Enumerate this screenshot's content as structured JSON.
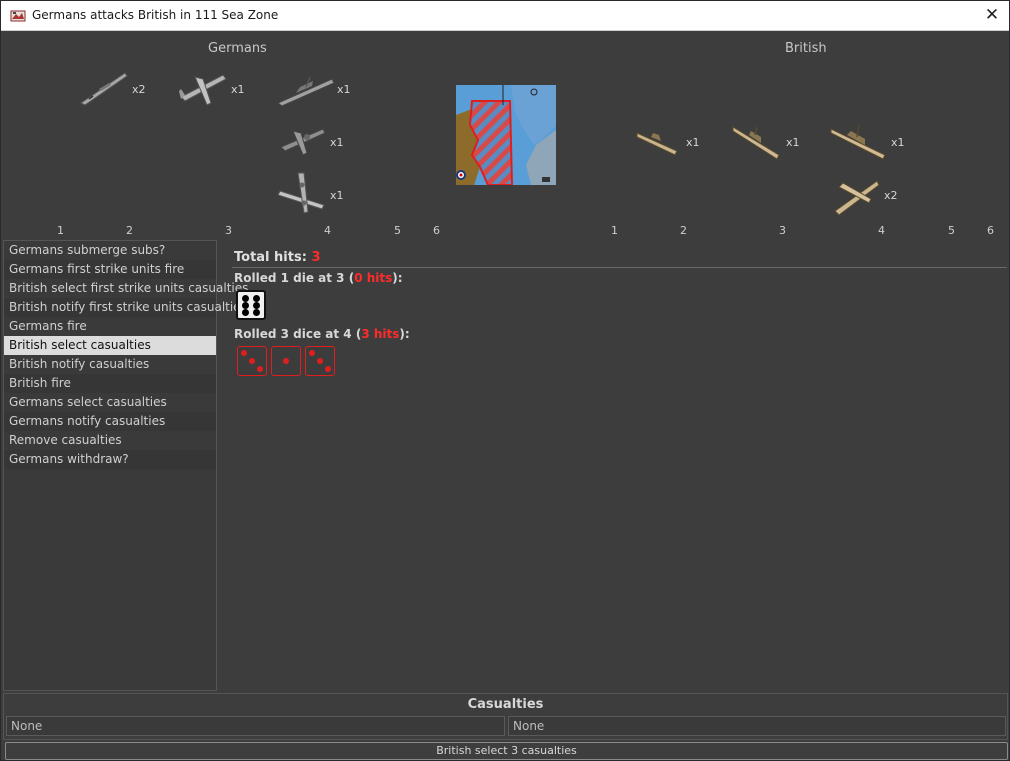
{
  "window": {
    "title": "Germans attacks British in 111 Sea Zone"
  },
  "attacker": {
    "label": "Germans",
    "units": [
      {
        "name": "destroyer",
        "count": "x2"
      },
      {
        "name": "fighter",
        "count": "x1"
      },
      {
        "name": "battleship",
        "count": "x1"
      },
      {
        "name": "tactical-bomber",
        "count": "x1"
      },
      {
        "name": "bomber",
        "count": "x1"
      }
    ],
    "columns": [
      "1",
      "2",
      "3",
      "4",
      "5",
      "6"
    ]
  },
  "defender": {
    "label": "British",
    "units": [
      {
        "name": "submarine",
        "count": "x1"
      },
      {
        "name": "cruiser",
        "count": "x1"
      },
      {
        "name": "battleship",
        "count": "x1"
      },
      {
        "name": "fighter",
        "count": "x2"
      }
    ],
    "columns": [
      "1",
      "2",
      "3",
      "4",
      "5",
      "6"
    ]
  },
  "steps": [
    "Germans submerge subs?",
    "Germans first strike units fire",
    "British select first strike units casualties",
    "British notify first strike units casualties",
    "Germans fire",
    "British select casualties",
    "British notify casualties",
    "British fire",
    "Germans select casualties",
    "Germans notify casualties",
    "Remove casualties",
    "Germans withdraw?"
  ],
  "selected_step": 5,
  "results": {
    "total_label": "Total hits: ",
    "total_value": "3",
    "roll1": {
      "prefix": "Rolled 1 die at 3 (",
      "hits": "0 hits",
      "suffix": "):",
      "dice": [
        6
      ]
    },
    "roll2": {
      "prefix": "Rolled 3 dice at 4 (",
      "hits": "3 hits",
      "suffix": "):",
      "dice": [
        3,
        1,
        3
      ]
    }
  },
  "casualties": {
    "title": "Casualties",
    "left": "None",
    "right": "None"
  },
  "status": "British select 3 casualties",
  "colors": {
    "hit_red": "#ff2b2b",
    "german_gray": "#b0b0b0",
    "british_tan": "#c8b490"
  }
}
